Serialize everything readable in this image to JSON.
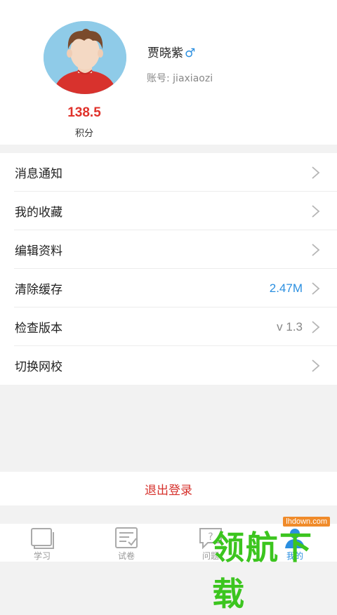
{
  "profile": {
    "name": "贾晓紫",
    "gender_symbol": "♂",
    "account": "账号: jiaxiaozi",
    "points_value": "138.5",
    "points_label": "积分"
  },
  "menu": {
    "items": [
      {
        "label": "消息通知",
        "value": ""
      },
      {
        "label": "我的收藏",
        "value": ""
      },
      {
        "label": "编辑资料",
        "value": ""
      },
      {
        "label": "清除缓存",
        "value": "2.47M"
      },
      {
        "label": "检查版本",
        "value": "v 1.3"
      },
      {
        "label": "切换网校",
        "value": ""
      }
    ]
  },
  "logout": {
    "label": "退出登录"
  },
  "tabbar": {
    "tabs": [
      {
        "label": "学习",
        "icon": "book-icon"
      },
      {
        "label": "试卷",
        "icon": "paper-icon"
      },
      {
        "label": "问题",
        "icon": "question-icon"
      },
      {
        "label": "我的",
        "icon": "user-icon",
        "active": true
      }
    ]
  },
  "watermark": {
    "text": "领航下载",
    "url": "lhdown.com"
  },
  "colors": {
    "accent_red": "#e0322b",
    "accent_blue": "#2b8fe0",
    "watermark_green": "#3cc51f"
  }
}
